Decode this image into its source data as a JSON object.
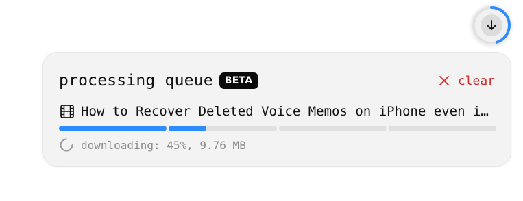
{
  "download_button": {
    "icon": "arrow-down-icon",
    "progress": 0.45,
    "ring_color": "#2f8cff"
  },
  "queue": {
    "title": "processing queue",
    "badge": "BETA",
    "clear_label": "clear",
    "clear_color": "#d32b2b"
  },
  "item": {
    "icon": "film-icon",
    "name": "How to Recover Deleted Voice Memos on iPhone even if not backed up",
    "segments": [
      1.0,
      0.35,
      0.0,
      0.0
    ],
    "progress_color": "#2f8cff",
    "status": "downloading: 45%, 9.76 MB"
  }
}
